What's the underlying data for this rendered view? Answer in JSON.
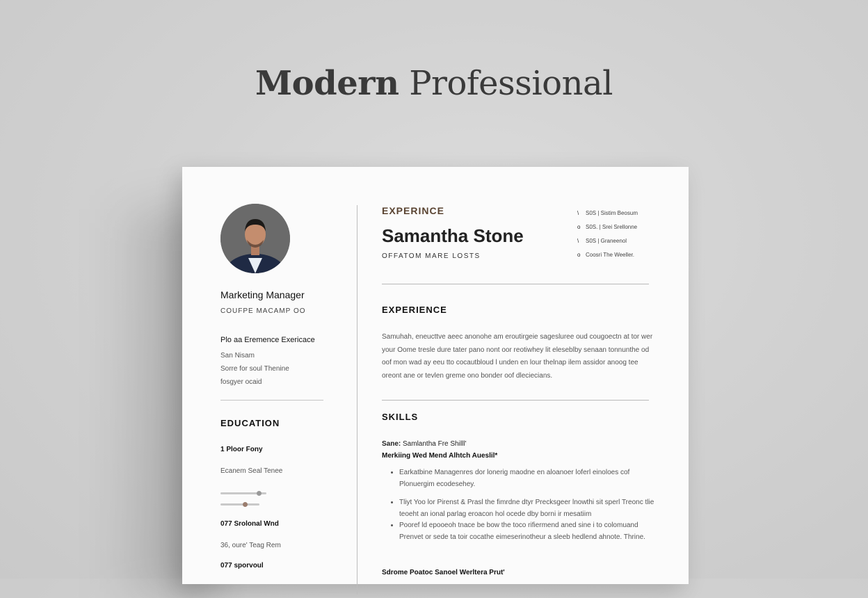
{
  "banner": {
    "title_bold": "Modern",
    "title_light": "Professional"
  },
  "left": {
    "role": "Marketing Manager",
    "company": "COUFPE MACAMP OO",
    "section_title": "Plo aa Eremence Exericace",
    "lines": [
      "San Nisam",
      "Sorre for soul Thenine",
      "fosgyer ocaid"
    ],
    "education_heading": "EDUCATION",
    "edu_items": [
      {
        "title": "1 Ploor Fony",
        "sub": "Ecanem Seal Tenee"
      },
      {
        "title": "077 Srolonal Wnd",
        "sub": "36, oure' Teag Rem"
      },
      {
        "title": "077 sporvoul",
        "sub": ""
      }
    ],
    "slider_levels": [
      0.8,
      0.45
    ]
  },
  "right": {
    "heading_top": "EXPERINCE",
    "name": "Samantha Stone",
    "subtitle": "OFFATOM MARE LOSTS",
    "contacts": [
      {
        "icon": "phone-icon",
        "glyph": "\\",
        "text": "S0S | Sistim Beosum"
      },
      {
        "icon": "location-icon",
        "glyph": "o",
        "text": "S0S. | Srei Srellonne"
      },
      {
        "icon": "phone-icon",
        "glyph": "\\",
        "text": "S0S | Graneenol"
      },
      {
        "icon": "location-icon",
        "glyph": "o",
        "text": "Coosri The Weeller."
      }
    ],
    "experience_heading": "EXPERIENCE",
    "experience_text": "Samuhah, eneucttve aeec anonohe am eroutirgeie sagesluree oud cougoectn at tor wer your Oome tresle dure tater pano nont oor reotiwhey lit eleseblby senaan tonnunthe od oof mon wad ay eeu tto cocautbloud l unden en lour thelnap ilem assidor anoog tee oreont ane or tevlen greme ono bonder oof dleciecians.",
    "skills_heading": "SKILLS",
    "skills_line1_bold": "Sane:",
    "skills_line1": " Samlantha Fre Shilll'",
    "skills_line2": "Merkiing Wed Mend Alhtch Aueslil*",
    "skills_list": [
      "Earkatbine Managenres dor lonerig maodne en aloanoer loferl einoloes cof Plonuergim ecodesehey.",
      "Tliyt Yoo lor Pirenst & Prasl the fimrdne dtyr Precksgeer lnowthi sit sperl Treonc tlie teoeht an ional parlag eroacon hol ocede dby borni ir mesatiim",
      "Pooref ld epooeoh tnace be bow the toco rifiermend aned sine i to colomuand Prenvet or sede ta toir cocathe eimeserinotheur a sleeb hedlend ahnote. Thrine."
    ],
    "footer": "Sdrome Poatoc Sanoel Werltera Prut'"
  }
}
